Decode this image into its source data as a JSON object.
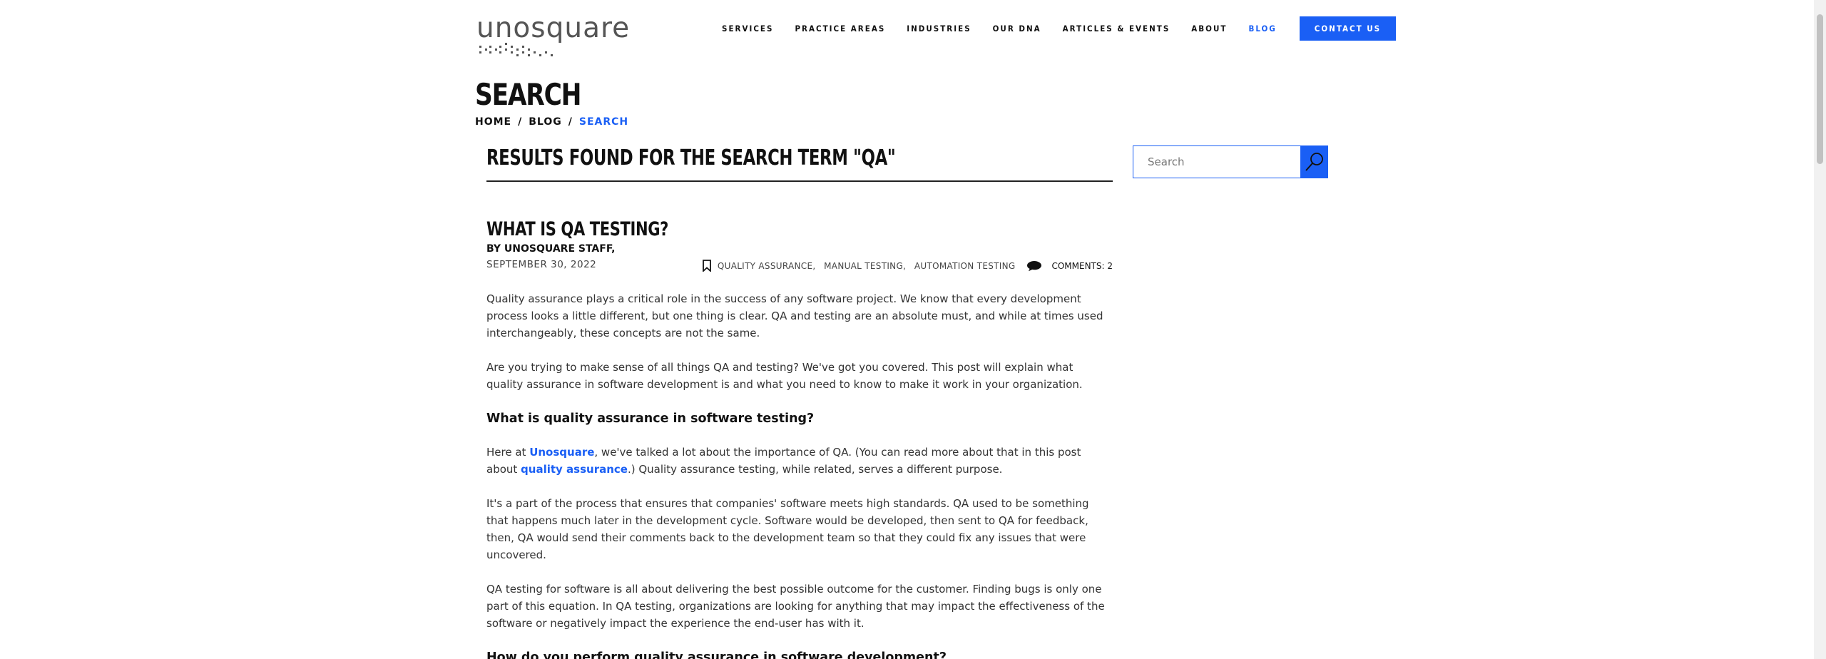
{
  "header": {
    "logo_text": "unosquare",
    "nav": [
      {
        "label": "SERVICES",
        "active": false
      },
      {
        "label": "PRACTICE AREAS",
        "active": false
      },
      {
        "label": "INDUSTRIES",
        "active": false
      },
      {
        "label": "OUR DNA",
        "active": false
      },
      {
        "label": "ARTICLES & EVENTS",
        "active": false
      },
      {
        "label": "ABOUT",
        "active": false
      },
      {
        "label": "BLOG",
        "active": true
      }
    ],
    "contact_label": "CONTACT US"
  },
  "page": {
    "title": "SEARCH",
    "breadcrumb": [
      "HOME",
      "/",
      "BLOG",
      "/",
      "SEARCH"
    ],
    "results_heading": "RESULTS FOUND FOR THE SEARCH TERM \"QA\""
  },
  "search": {
    "placeholder": "Search",
    "value": "",
    "button_icon": "search-icon"
  },
  "article": {
    "title": "WHAT IS QA TESTING?",
    "byline": "BY UNOSQUARE STAFF,",
    "date": "SEPTEMBER 30, 2022",
    "tag_icon": "bookmark-icon",
    "tags": [
      "QUALITY ASSURANCE",
      "MANUAL TESTING",
      "AUTOMATION TESTING"
    ],
    "tag_separator": ",",
    "comments_icon": "comment-bubble-icon",
    "comments": "COMMENTS: 2",
    "p1": "Quality assurance plays a critical role in the success of any software project. We know that every development process looks a little different, but one thing is clear. QA and testing are an absolute must, and while at times used interchangeably, these concepts are not the same.",
    "p2": "Are you trying to make sense of all things QA and testing? We've got you covered. This post will explain what quality assurance in software development is and what you need to know to make it work in your organization.",
    "h1": "What is quality assurance in software testing?",
    "p3_a": "Here at ",
    "p3_link1": "Unosquare",
    "p3_b": ", we've talked a lot about the importance of QA. (You can read more about that in this post about ",
    "p3_link2": "quality assurance",
    "p3_c": ".) Quality assurance testing, while related, serves a different purpose.",
    "p4": "It's a part of the process that ensures that companies' software meets high standards. QA used to be something that happens much later in the development cycle. Software would be developed, then sent to QA for feedback, then, QA would send their comments back to the development team so that they could fix any issues that were uncovered.",
    "p5": "QA testing for software is all about delivering the best possible outcome for the customer. Finding bugs is only one part of this equation. In QA testing, organizations are looking for anything that may impact the effectiveness of the software or negatively impact the experience the end-user has with it.",
    "h2": "How do you perform quality assurance in software development?"
  },
  "colors": {
    "accent": "#1a5ff5",
    "text": "#222222"
  }
}
